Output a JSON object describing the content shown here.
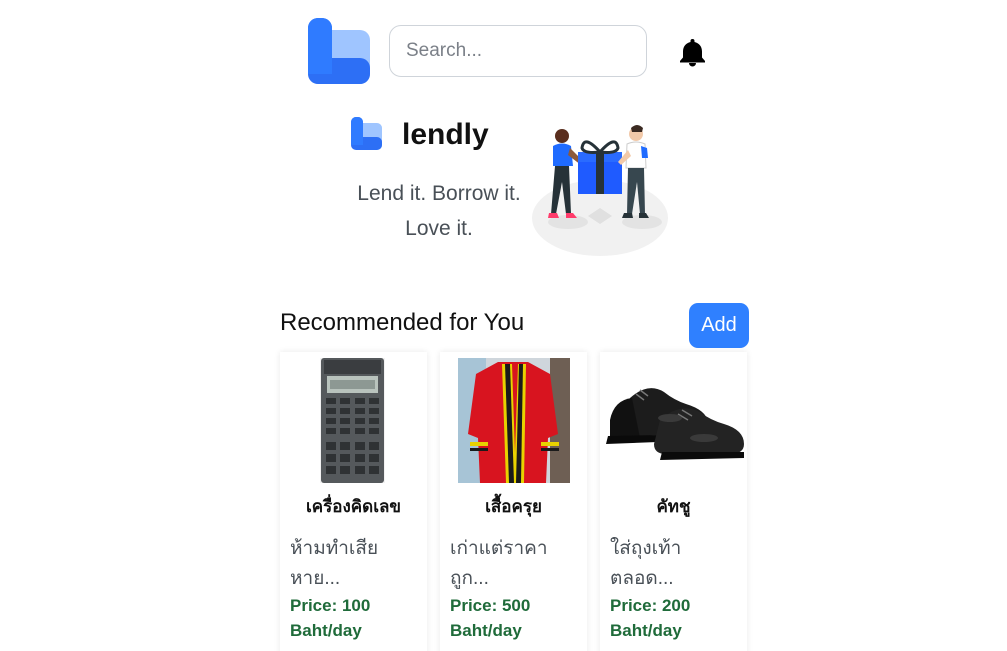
{
  "header": {
    "logo_icon": "lendly-logo-icon",
    "search_placeholder": "Search...",
    "bell_icon": "bell-icon"
  },
  "hero": {
    "brand_name": "lendly",
    "tagline_line1": "Lend it. Borrow it.",
    "tagline_line2": "Love it."
  },
  "recommended": {
    "title": "Recommended for You",
    "add_label": "Add",
    "items": [
      {
        "title": "เครื่องคิดเลข",
        "desc_line1": "ห้ามทำเสีย",
        "desc_line2": "หาย...",
        "price_line1": "Price: 100",
        "price_line2": "Baht/day"
      },
      {
        "title": "เสื้อครุย",
        "desc_line1": "เก่าแต่ราคา",
        "desc_line2": "ถูก...",
        "price_line1": "Price: 500",
        "price_line2": "Baht/day"
      },
      {
        "title": "คัทชู",
        "desc_line1": "ใส่ถุงเท้า",
        "desc_line2": "ตลอด...",
        "price_line1": "Price: 200",
        "price_line2": "Baht/day"
      }
    ]
  },
  "colors": {
    "primary": "#2f80ff",
    "price_green": "#1f6b3a",
    "muted_text": "#495057"
  }
}
